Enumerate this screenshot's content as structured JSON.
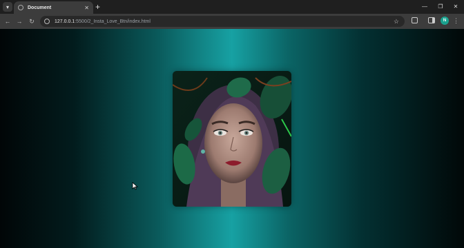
{
  "browser": {
    "tab_title": "Document",
    "url_host": "127.0.0.1",
    "url_path": ":5500/2_Insta_Love_Btn/index.html",
    "profile_initial": "N"
  },
  "page": {
    "image_alt": "Portrait of a woman with purple hair framed by green leaves"
  },
  "colors": {
    "teal_center": "#17a1a3",
    "edge": "#010607",
    "avatar": "#1aa28f"
  }
}
